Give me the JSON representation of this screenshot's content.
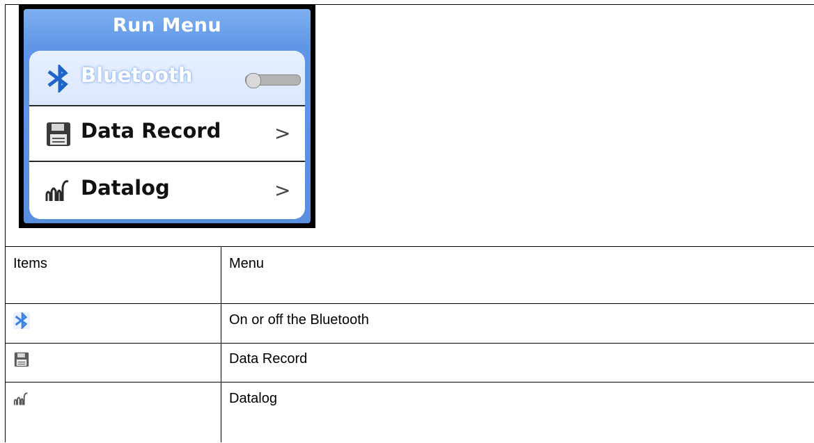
{
  "device": {
    "title": "Run Menu",
    "items": [
      {
        "icon": "bluetooth-icon",
        "label": "Bluetooth",
        "control": "toggle",
        "selected": true,
        "toggle_on": false
      },
      {
        "icon": "floppy-disk-icon",
        "label": "Data Record",
        "control": "chevron",
        "chevron": ">"
      },
      {
        "icon": "datalog-chart-icon",
        "label": "Datalog",
        "control": "chevron",
        "chevron": ">"
      }
    ],
    "colors": {
      "header_blue": "#5f95e6",
      "selected_row": "#dde8fc"
    }
  },
  "table": {
    "headers": [
      "Items",
      "Menu"
    ],
    "rows": [
      {
        "icon": "bluetooth-icon",
        "description": "On or off the Bluetooth"
      },
      {
        "icon": "floppy-disk-icon",
        "description": "Data Record"
      },
      {
        "icon": "datalog-chart-icon",
        "description": "Datalog"
      }
    ]
  }
}
